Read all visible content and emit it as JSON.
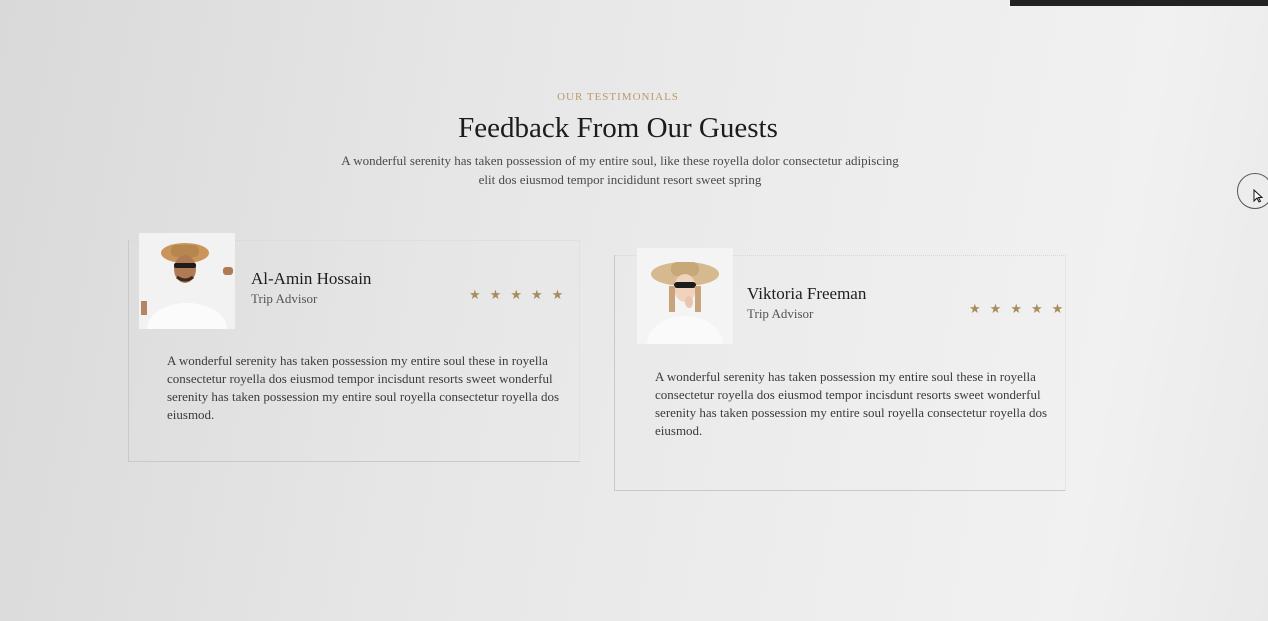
{
  "section": {
    "eyebrow": "OUR TESTIMONIALS",
    "title": "Feedback From Our Guests",
    "subtitle": "A wonderful serenity has taken possession of my entire soul, like these royella dolor consectetur adipiscing elit dos eiusmod tempor incididunt resort sweet spring"
  },
  "testimonials": [
    {
      "name": "Al-Amin Hossain",
      "source": "Trip Advisor",
      "rating": 5,
      "quote": "A wonderful serenity has taken possession my entire soul these in royella consectetur royella dos eiusmod tempor incisdunt resorts sweet wonderful serenity has taken possession my entire soul royella consectetur royella dos eiusmod.",
      "avatar_icon": "man-with-hat-and-sunglasses"
    },
    {
      "name": "Viktoria Freeman",
      "source": "Trip Advisor",
      "rating": 5,
      "quote": "A wonderful serenity has taken possession my entire soul these in royella consectetur royella dos eiusmod tempor incisdunt resorts sweet wonderful serenity has taken possession my entire soul royella consectetur royella dos eiusmod.",
      "avatar_icon": "woman-with-hat-and-sunglasses"
    }
  ],
  "colors": {
    "accent": "#b79b6c",
    "star": "#a88c5c",
    "heading": "#1c1c1c"
  }
}
